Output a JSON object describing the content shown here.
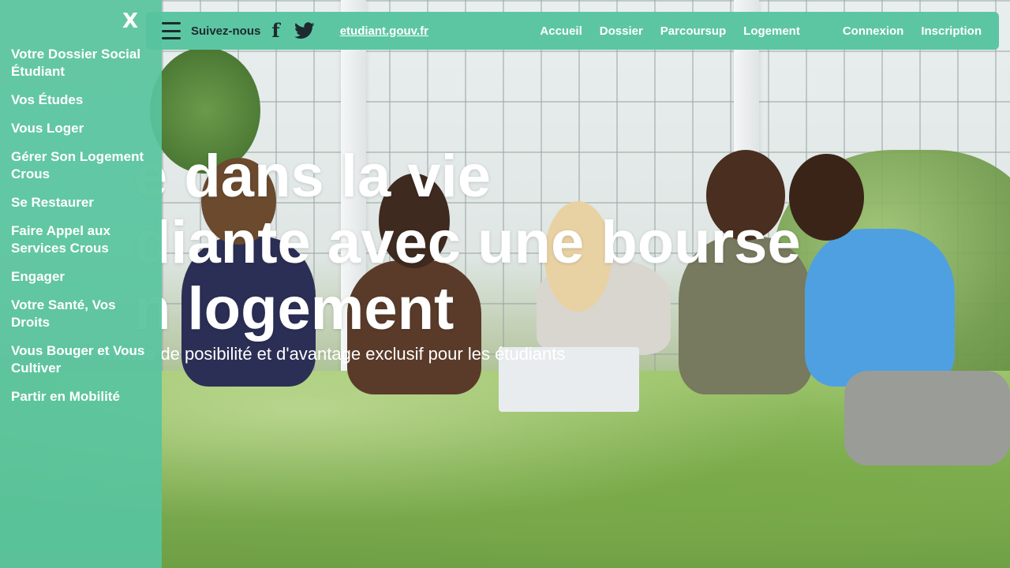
{
  "header": {
    "follow_label": "Suivez-nous",
    "social": [
      {
        "icon": "facebook-icon",
        "glyph": "f"
      },
      {
        "icon": "twitter-icon"
      }
    ],
    "site_link": "etudiant.gouv.fr",
    "nav": [
      "Accueil",
      "Dossier",
      "Parcoursup",
      "Logement"
    ],
    "auth": [
      "Connexion",
      "Inscription"
    ],
    "bar_color": "#5cc6a2"
  },
  "hero": {
    "title_line1": "e dans la vie",
    "title_line2": "diante avec une bourse",
    "title_line3": "n logement",
    "subtitle": "monde de posibilité et d'avantage exclusif pour les étudiants"
  },
  "drawer": {
    "close_label": "X",
    "items": [
      "Votre Dossier Social Étudiant",
      "Vos Études",
      "Vous Loger",
      "Gérer Son Logement Crous",
      "Se Restaurer",
      "Faire Appel aux Services Crous",
      "Engager",
      "Votre Santé, Vos Droits",
      "Vous Bouger et Vous Cultiver",
      "Partir en Mobilité"
    ],
    "color": "#58c49e"
  }
}
